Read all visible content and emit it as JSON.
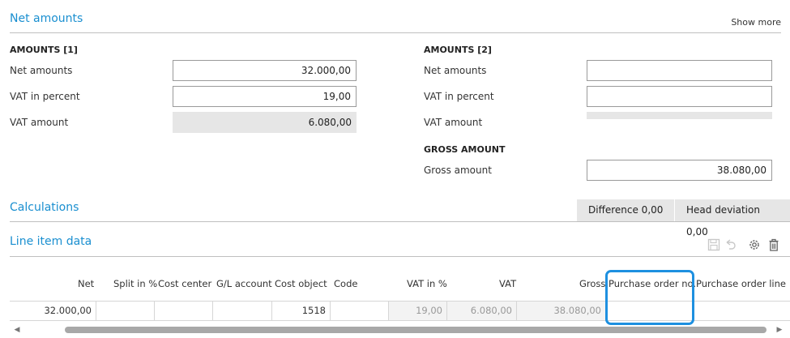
{
  "net_section": {
    "title": "Net amounts",
    "show_more": "Show more",
    "amounts1": {
      "title": "AMOUNTS [1]",
      "net_label": "Net amounts",
      "net_value": "32.000,00",
      "vat_pct_label": "VAT in percent",
      "vat_pct_value": "19,00",
      "vat_amount_label": "VAT amount",
      "vat_amount_value": "6.080,00"
    },
    "amounts2": {
      "title": "AMOUNTS [2]",
      "net_label": "Net amounts",
      "net_value": "",
      "vat_pct_label": "VAT in percent",
      "vat_pct_value": "",
      "vat_amount_label": "VAT amount",
      "vat_amount_value": ""
    },
    "gross": {
      "title": "GROSS AMOUNT",
      "label": "Gross amount",
      "value": "38.080,00"
    }
  },
  "calculations": {
    "title": "Calculations",
    "difference": "Difference  0,00",
    "head_deviation": "Head deviation 0,00"
  },
  "line_items": {
    "title": "Line item data",
    "icons": [
      "save-icon",
      "undo-icon",
      "gear-icon",
      "trash-icon"
    ],
    "columns": [
      "Net",
      "Split in %",
      "Cost center",
      "G/L account",
      "Cost object",
      "Code",
      "VAT in %",
      "VAT",
      "Gross",
      "Purchase order no.",
      "Purchase order line"
    ],
    "row": {
      "net": "32.000,00",
      "split": "",
      "cost_center": "",
      "gl_account": "",
      "cost_object": "1518",
      "code": "",
      "vat_pct": "19,00",
      "vat": "6.080,00",
      "gross": "38.080,00",
      "po_no": "",
      "po_line": ""
    }
  },
  "colors": {
    "accent": "#1a8fd0",
    "highlight": "#1e90e0",
    "readonly_bg": "#e6e6e6"
  }
}
